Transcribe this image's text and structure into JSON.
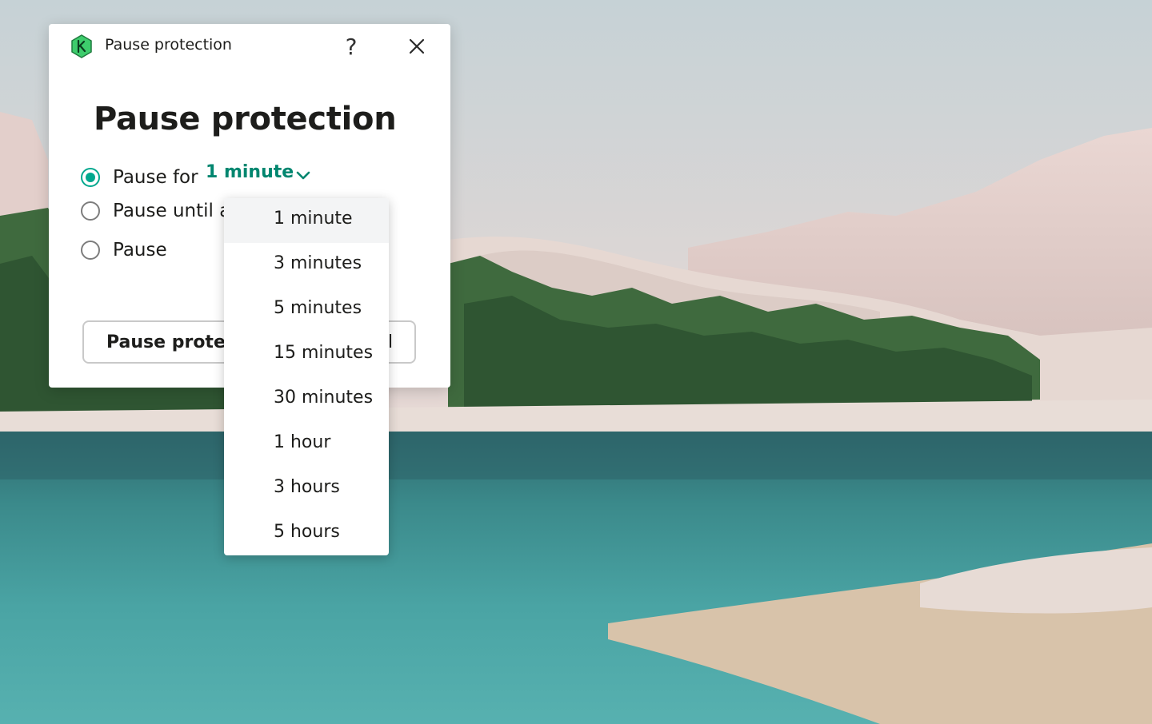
{
  "titlebar": {
    "title": "Pause protection",
    "help_label": "?"
  },
  "dialog": {
    "heading": "Pause protection",
    "options": [
      {
        "label": "Pause for",
        "checked": true
      },
      {
        "label": "Pause until a",
        "checked": false
      },
      {
        "label": "Pause",
        "checked": false
      }
    ],
    "pause_for_value": "1 minute",
    "primary_button_label": "Pause protec",
    "cancel_button_label": "l"
  },
  "dropdown": {
    "items": [
      {
        "label": "1 minute",
        "selected": true
      },
      {
        "label": "3 minutes"
      },
      {
        "label": "5 minutes"
      },
      {
        "label": "15 minutes"
      },
      {
        "label": "30 minutes"
      },
      {
        "label": "1 hour"
      },
      {
        "label": "3 hours"
      },
      {
        "label": "5 hours"
      }
    ]
  },
  "colors": {
    "accent": "#00a88e",
    "accent_text": "#00866f",
    "logo_green": "#3dcc6c"
  },
  "icons": {
    "app": "kaspersky-logo-icon",
    "help": "help-icon",
    "close": "close-icon",
    "chevron": "chevron-down-icon"
  }
}
